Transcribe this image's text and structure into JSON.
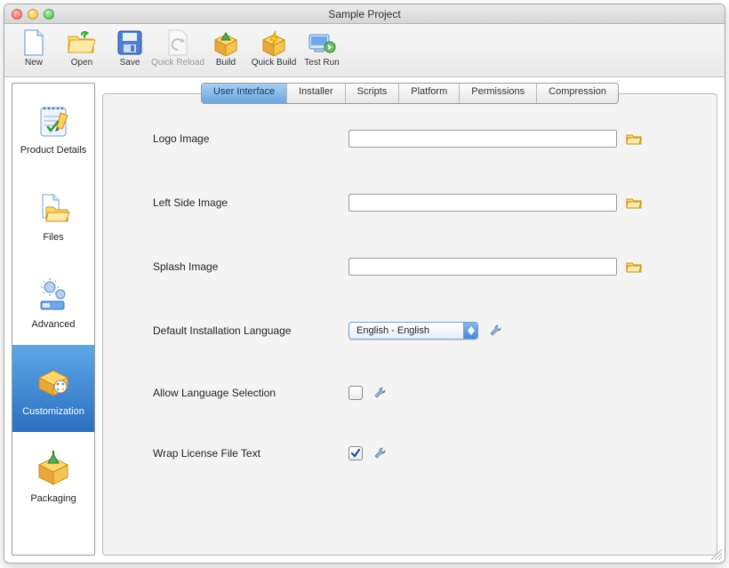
{
  "window": {
    "title": "Sample Project"
  },
  "toolbar": {
    "new": "New",
    "open": "Open",
    "save": "Save",
    "quick_reload": "Quick Reload",
    "build": "Build",
    "quick_build": "Quick Build",
    "test_run": "Test Run"
  },
  "sidebar": {
    "items": [
      {
        "label": "Product Details"
      },
      {
        "label": "Files"
      },
      {
        "label": "Advanced"
      },
      {
        "label": "Customization"
      },
      {
        "label": "Packaging"
      }
    ],
    "selected_index": 3
  },
  "tabs": {
    "items": [
      "User Interface",
      "Installer",
      "Scripts",
      "Platform",
      "Permissions",
      "Compression"
    ],
    "active_index": 0
  },
  "form": {
    "logo_image": {
      "label": "Logo Image",
      "value": ""
    },
    "left_side_image": {
      "label": "Left Side Image",
      "value": ""
    },
    "splash_image": {
      "label": "Splash Image",
      "value": ""
    },
    "default_lang": {
      "label": "Default Installation Language",
      "value": "English - English"
    },
    "allow_lang_sel": {
      "label": "Allow Language Selection",
      "checked": false
    },
    "wrap_license": {
      "label": "Wrap License File Text",
      "checked": true
    }
  }
}
